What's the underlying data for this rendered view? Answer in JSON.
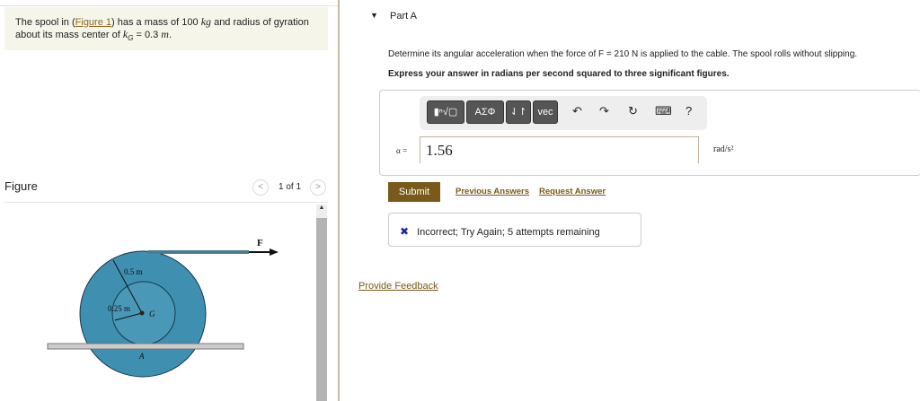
{
  "problem": {
    "text1": "The spool in (",
    "figure_link": "Figure 1",
    "text2": ") has a mass of 100 ",
    "kg": "kg",
    "text3": " and radius of gyration",
    "text4": "about its mass center of ",
    "kG": "k",
    "kG_sub": "G",
    "text5": " = 0.3 ",
    "m": "m",
    "text6": "."
  },
  "figure": {
    "title": "Figure",
    "pager": "1 of 1",
    "prev": "<",
    "next": ">",
    "labels": {
      "F": "F",
      "outer": "0.5 m",
      "inner": "0.25 m",
      "G": "G",
      "A": "A"
    }
  },
  "part": {
    "title": "Part A",
    "caret": "▼",
    "question": "Determine its angular acceleration when the force of F = 210 N is applied to the cable. The spool rolls without slipping.",
    "instruction": "Express your answer in radians per second squared to three significant figures.",
    "toolbar": {
      "templates": "▮ⁿ√▢",
      "greek": "ΑΣΦ",
      "arrows": "⇃↾",
      "vec": "vec",
      "undo": "↶",
      "redo": "↷",
      "reset": "↻",
      "keyboard": "⌨",
      "help": "?"
    },
    "var_label": "α =",
    "answer": "1.56",
    "units": "rad/s²"
  },
  "actions": {
    "submit": "Submit",
    "previous": "Previous Answers",
    "request": "Request Answer"
  },
  "feedback": {
    "icon": "✖",
    "text": "Incorrect; Try Again; 5 attempts remaining"
  },
  "provide_feedback": "Provide Feedback"
}
